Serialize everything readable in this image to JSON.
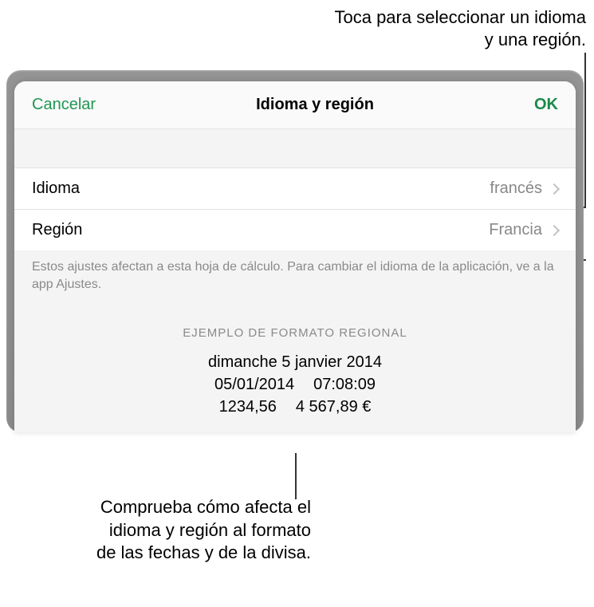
{
  "callouts": {
    "top": "Toca para seleccionar un idioma y una región.",
    "bottom": "Comprueba cómo afecta el idioma y región al formato de las fechas y de la divisa."
  },
  "sheet": {
    "cancel": "Cancelar",
    "title": "Idioma y región",
    "ok": "OK",
    "rows": {
      "language": {
        "label": "Idioma",
        "value": "francés"
      },
      "region": {
        "label": "Región",
        "value": "Francia"
      }
    },
    "footer_note": "Estos ajustes afectan a esta hoja de cálculo. Para cambiar el idioma de la aplicación, ve a la app Ajustes.",
    "example": {
      "header": "EJEMPLO DE FORMATO REGIONAL",
      "long_date": "dimanche 5 janvier 2014",
      "short_date": "05/01/2014",
      "time": "07:08:09",
      "number": "1234,56",
      "currency": "4 567,89 €"
    }
  }
}
